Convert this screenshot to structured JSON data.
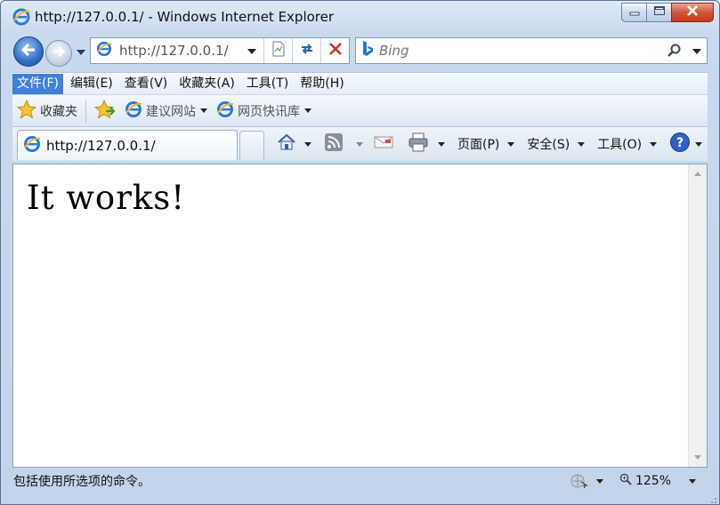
{
  "window": {
    "title": "http://127.0.0.1/ - Windows Internet Explorer",
    "colors": {
      "accent": "#3f80d8",
      "close": "#c23b1c",
      "frame": "#c9d9ee"
    }
  },
  "address": {
    "url": "http://127.0.0.1/"
  },
  "search": {
    "placeholder": "Bing",
    "icon": "search-icon"
  },
  "menu": {
    "items": [
      {
        "label": "文件(F)",
        "active": true
      },
      {
        "label": "编辑(E)"
      },
      {
        "label": "查看(V)"
      },
      {
        "label": "收藏夹(A)"
      },
      {
        "label": "工具(T)"
      },
      {
        "label": "帮助(H)"
      }
    ]
  },
  "favorites": {
    "favorites_label": "收藏夹",
    "suggested_sites": "建议网站",
    "web_slice_gallery": "网页快讯库"
  },
  "tab": {
    "title": "http://127.0.0.1/"
  },
  "commandbar": {
    "page": "页面(P)",
    "safety": "安全(S)",
    "tools": "工具(O)"
  },
  "page": {
    "heading": "It works!"
  },
  "status": {
    "text": "包括使用所选项的命令。",
    "zoom": "125%"
  }
}
